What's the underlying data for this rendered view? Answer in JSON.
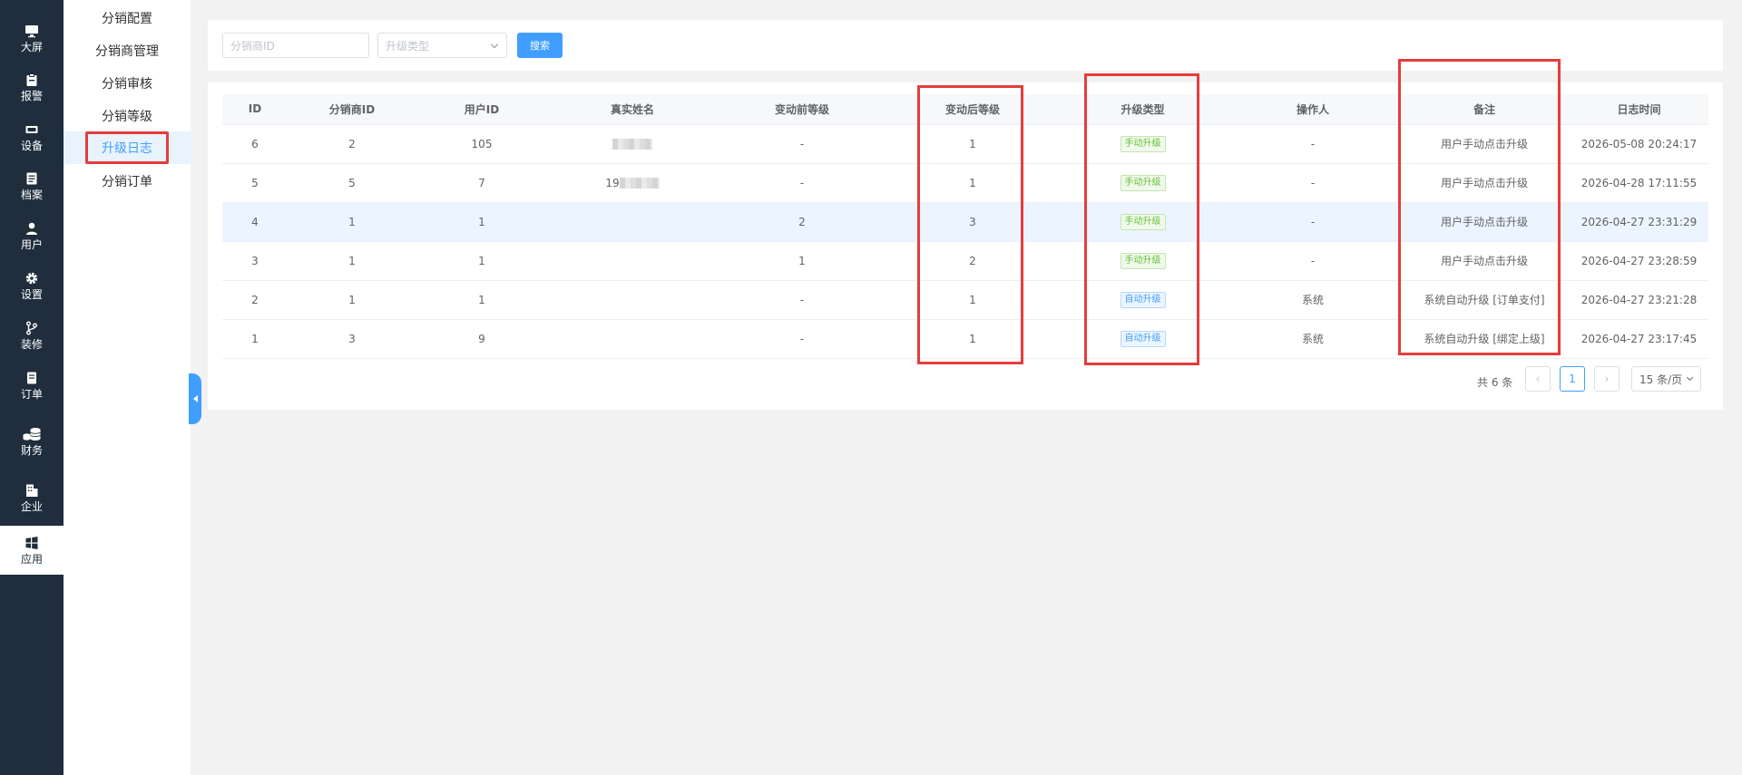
{
  "rail": {
    "items": [
      {
        "label": "大屏",
        "icon": "monitor-icon"
      },
      {
        "label": "报警",
        "icon": "clipboard-alarm-icon"
      },
      {
        "label": "设备",
        "icon": "device-icon"
      },
      {
        "label": "档案",
        "icon": "file-icon"
      },
      {
        "label": "用户",
        "icon": "user-icon"
      },
      {
        "label": "设置",
        "icon": "gear-icon"
      },
      {
        "label": "装修",
        "icon": "branch-icon"
      },
      {
        "label": "订单",
        "icon": "order-icon"
      },
      {
        "label": "财务",
        "icon": "coins-icon"
      },
      {
        "label": "企业",
        "icon": "building-icon"
      },
      {
        "label": "应用",
        "icon": "apps-grid-icon"
      }
    ],
    "active_label": "应用"
  },
  "submenu": {
    "items": [
      "分销配置",
      "分销商管理",
      "分销审核",
      "分销等级",
      "升级日志",
      "分销订单"
    ],
    "active_label": "升级日志"
  },
  "search": {
    "distributor_placeholder": "分销商ID",
    "type_placeholder": "升级类型",
    "button_label": "搜索"
  },
  "table": {
    "headers": [
      "ID",
      "分销商ID",
      "用户ID",
      "真实姓名",
      "变动前等级",
      "变动后等级",
      "升级类型",
      "操作人",
      "备注",
      "日志时间"
    ],
    "rows": [
      {
        "id": "6",
        "distributor_id": "2",
        "user_id": "105",
        "real_name": "",
        "before": "-",
        "after": "1",
        "type": "手动升级",
        "type_kind": "manual",
        "operator": "-",
        "remark": "用户手动点击升级",
        "time": "2026-05-08 20:24:17"
      },
      {
        "id": "5",
        "distributor_id": "5",
        "user_id": "7",
        "real_name": "19",
        "before": "-",
        "after": "1",
        "type": "手动升级",
        "type_kind": "manual",
        "operator": "-",
        "remark": "用户手动点击升级",
        "time": "2026-04-28 17:11:55"
      },
      {
        "id": "4",
        "distributor_id": "1",
        "user_id": "1",
        "real_name": "",
        "before": "2",
        "after": "3",
        "type": "手动升级",
        "type_kind": "manual",
        "operator": "-",
        "remark": "用户手动点击升级",
        "time": "2026-04-27 23:31:29"
      },
      {
        "id": "3",
        "distributor_id": "1",
        "user_id": "1",
        "real_name": "",
        "before": "1",
        "after": "2",
        "type": "手动升级",
        "type_kind": "manual",
        "operator": "-",
        "remark": "用户手动点击升级",
        "time": "2026-04-27 23:28:59"
      },
      {
        "id": "2",
        "distributor_id": "1",
        "user_id": "1",
        "real_name": "",
        "before": "-",
        "after": "1",
        "type": "自动升级",
        "type_kind": "auto",
        "operator": "系统",
        "remark": "系统自动升级 [订单支付]",
        "time": "2026-04-27 23:21:28"
      },
      {
        "id": "1",
        "distributor_id": "3",
        "user_id": "9",
        "real_name": "",
        "before": "-",
        "after": "1",
        "type": "自动升级",
        "type_kind": "auto",
        "operator": "系统",
        "remark": "系统自动升级 [绑定上级]",
        "time": "2026-04-27 23:17:45"
      }
    ]
  },
  "pagination": {
    "total_text": "共 6 条",
    "prev": "‹",
    "current_page": "1",
    "next": "›",
    "page_size": "15 条/页"
  },
  "colors": {
    "rail_bg": "#1f2d3d",
    "accent": "#409eff",
    "manual_tag": "#67c23a",
    "annotation_red": "#e63c3c"
  }
}
